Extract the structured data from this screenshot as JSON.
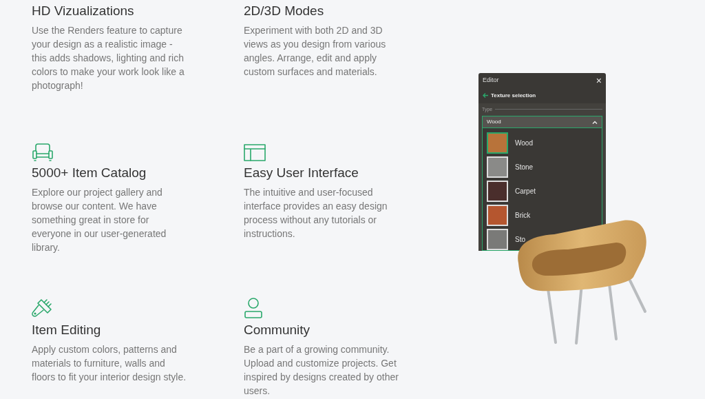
{
  "features": [
    {
      "title": "HD Vizualizations",
      "text": "Use the Renders feature to capture your design as a realistic image - this adds shadows, lighting and rich colors to make your work look like a photograph!"
    },
    {
      "title": "2D/3D Modes",
      "text": "Experiment with both 2D and 3D views as you design from various angles. Arrange, edit and apply custom surfaces and materials."
    },
    {
      "title": "5000+ Item Catalog",
      "text": "Explore our project gallery and browse our content. We have something great in store for everyone in our user-generated library."
    },
    {
      "title": "Easy User Interface",
      "text": "The intuitive and user-focused interface provides an easy design process without any tutorials or instructions."
    },
    {
      "title": "Item Editing",
      "text": "Apply custom colors, patterns and materials to furniture, walls and floors to fit your interior design style."
    },
    {
      "title": "Community",
      "text": "Be a part of a growing community. Upload and customize projects. Get inspired by designs created by other users."
    }
  ],
  "editor": {
    "title": "Editor",
    "close": "×",
    "back_label": "Texture selection",
    "type_label": "Type",
    "dropdown": {
      "value": "Wood",
      "expanded": true
    },
    "textures": [
      {
        "label": "Wood",
        "selected": true,
        "color": "#b8733a"
      },
      {
        "label": "Stone",
        "selected": false,
        "color": "#8a8a88"
      },
      {
        "label": "Carpet",
        "selected": false,
        "color": "#4a2e2c"
      },
      {
        "label": "Brick",
        "selected": false,
        "color": "#b5562f"
      },
      {
        "label": "Sto",
        "selected": false,
        "color": "#7a7a78"
      }
    ]
  }
}
